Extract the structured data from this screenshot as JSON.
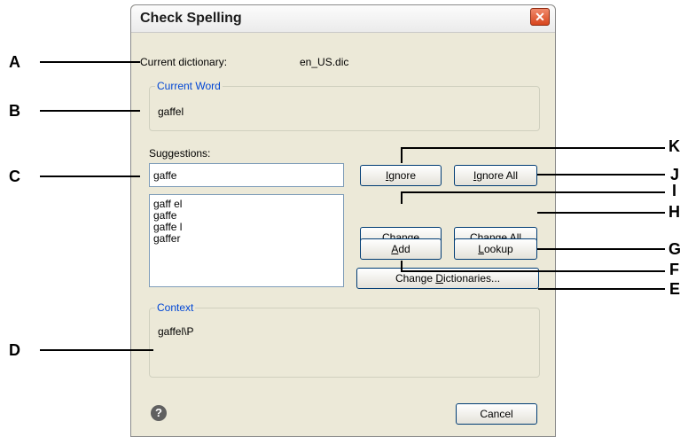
{
  "dialog": {
    "title": "Check Spelling",
    "close_glyph": "✕",
    "current_dictionary_label": "Current dictionary:",
    "current_dictionary_value": "en_US.dic",
    "current_word_legend": "Current Word",
    "current_word_value": "gaffel",
    "suggestions_label": "Suggestions:",
    "suggestion_input_value": "gaffe",
    "suggestions": [
      "gaff el",
      "gaffe",
      "gaffe l",
      "gaffer"
    ],
    "context_legend": "Context",
    "context_value": "gaffel\\P",
    "help_glyph": "?",
    "buttons": {
      "ignore": {
        "pre": "",
        "key": "I",
        "post": "gnore"
      },
      "ignore_all": {
        "pre": "",
        "key": "I",
        "post": "gnore All"
      },
      "change": {
        "pre": "",
        "key": "C",
        "post": "hange"
      },
      "change_all": {
        "pre": "Change ",
        "key": "A",
        "post": "ll"
      },
      "add": {
        "pre": "",
        "key": "A",
        "post": "dd"
      },
      "lookup": {
        "pre": "",
        "key": "L",
        "post": "ookup"
      },
      "change_dictionaries": {
        "pre": "Change ",
        "key": "D",
        "post": "ictionaries..."
      },
      "cancel": "Cancel"
    }
  },
  "callouts": {
    "a": "A",
    "b": "B",
    "c": "C",
    "d": "D",
    "e": "E",
    "f": "F",
    "g": "G",
    "h": "H",
    "i": "I",
    "j": "J",
    "k": "K"
  }
}
